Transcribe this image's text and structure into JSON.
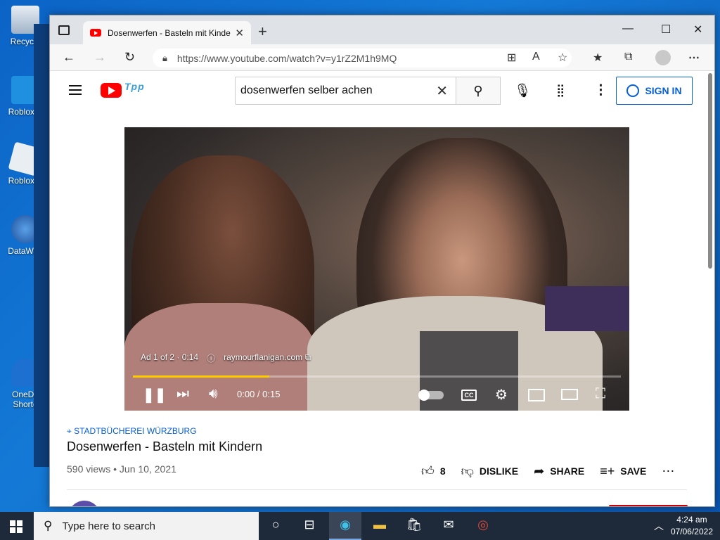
{
  "desktop": {
    "icons": [
      {
        "label": "Recycle"
      },
      {
        "label": "Roblox S"
      },
      {
        "label": "Roblox P"
      },
      {
        "label": "DataWag"
      },
      {
        "label": "OneDri"
      },
      {
        "label": "Shorto"
      }
    ]
  },
  "browser": {
    "tab_title": "Dosenwerfen - Basteln mit Kinde",
    "url": "https://www.youtube.com/watch?v=y1rZ2M1h9MQ"
  },
  "youtube": {
    "doodle_text": "Tpp",
    "search_value": "dosenwerfen selber achen",
    "signin_label": "SIGN IN",
    "player": {
      "ad_text": "Ad 1 of 2 · 0:14",
      "ad_domain": "raymourflanigan.com",
      "time": "0:00 / 0:15",
      "ad_progress_fraction": 0.28,
      "cc_label": "CC"
    },
    "video": {
      "location": "STADTBÜCHEREI WÜRZBURG",
      "title": "Dosenwerfen - Basteln mit Kindern",
      "meta": "590 views • Jun 10, 2021",
      "likes": "8",
      "dislike_label": "DISLIKE",
      "share_label": "SHARE",
      "save_label": "SAVE"
    }
  },
  "taskbar": {
    "search_placeholder": "Type here to search",
    "time": "4:24 am",
    "date": "07/06/2022"
  },
  "colors": {
    "youtube_red": "#ff0000",
    "link_blue": "#065fd4",
    "ad_progress": "#ffcc00"
  }
}
